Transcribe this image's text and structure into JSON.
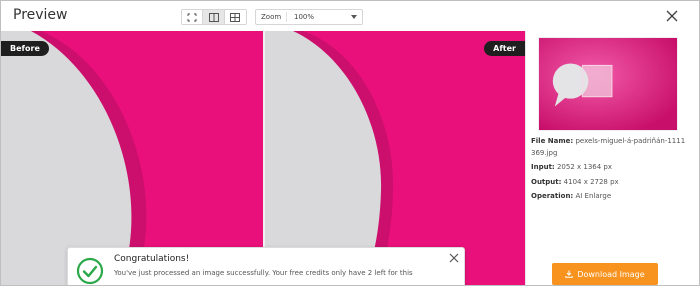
{
  "header": {
    "title": "Preview",
    "view_modes": [
      {
        "name": "fit-view-icon",
        "active": false
      },
      {
        "name": "split-view-icon",
        "active": true
      },
      {
        "name": "compare-view-icon",
        "active": false
      }
    ],
    "zoom_label": "Zoom",
    "zoom_value": "100%"
  },
  "panels": {
    "before_label": "Before",
    "after_label": "After",
    "image_color": "#e9107b"
  },
  "details": {
    "file_name_label": "File Name:",
    "file_name": "pexels-miguel-á-padriñán-1111369.jpg",
    "input_label": "Input:",
    "input_value": "2052 x 1364 px",
    "output_label": "Output:",
    "output_value": "4104 x 2728 px",
    "operation_label": "Operation:",
    "operation_value": "AI Enlarge",
    "download_label": "Download Image",
    "accent_color": "#f7931e"
  },
  "toast": {
    "title": "Congratulations!",
    "message": "You've just processed an image successfully. Your free credits only have 2 left for this",
    "icon": "check-circle-icon",
    "icon_color": "#2aa84a"
  }
}
